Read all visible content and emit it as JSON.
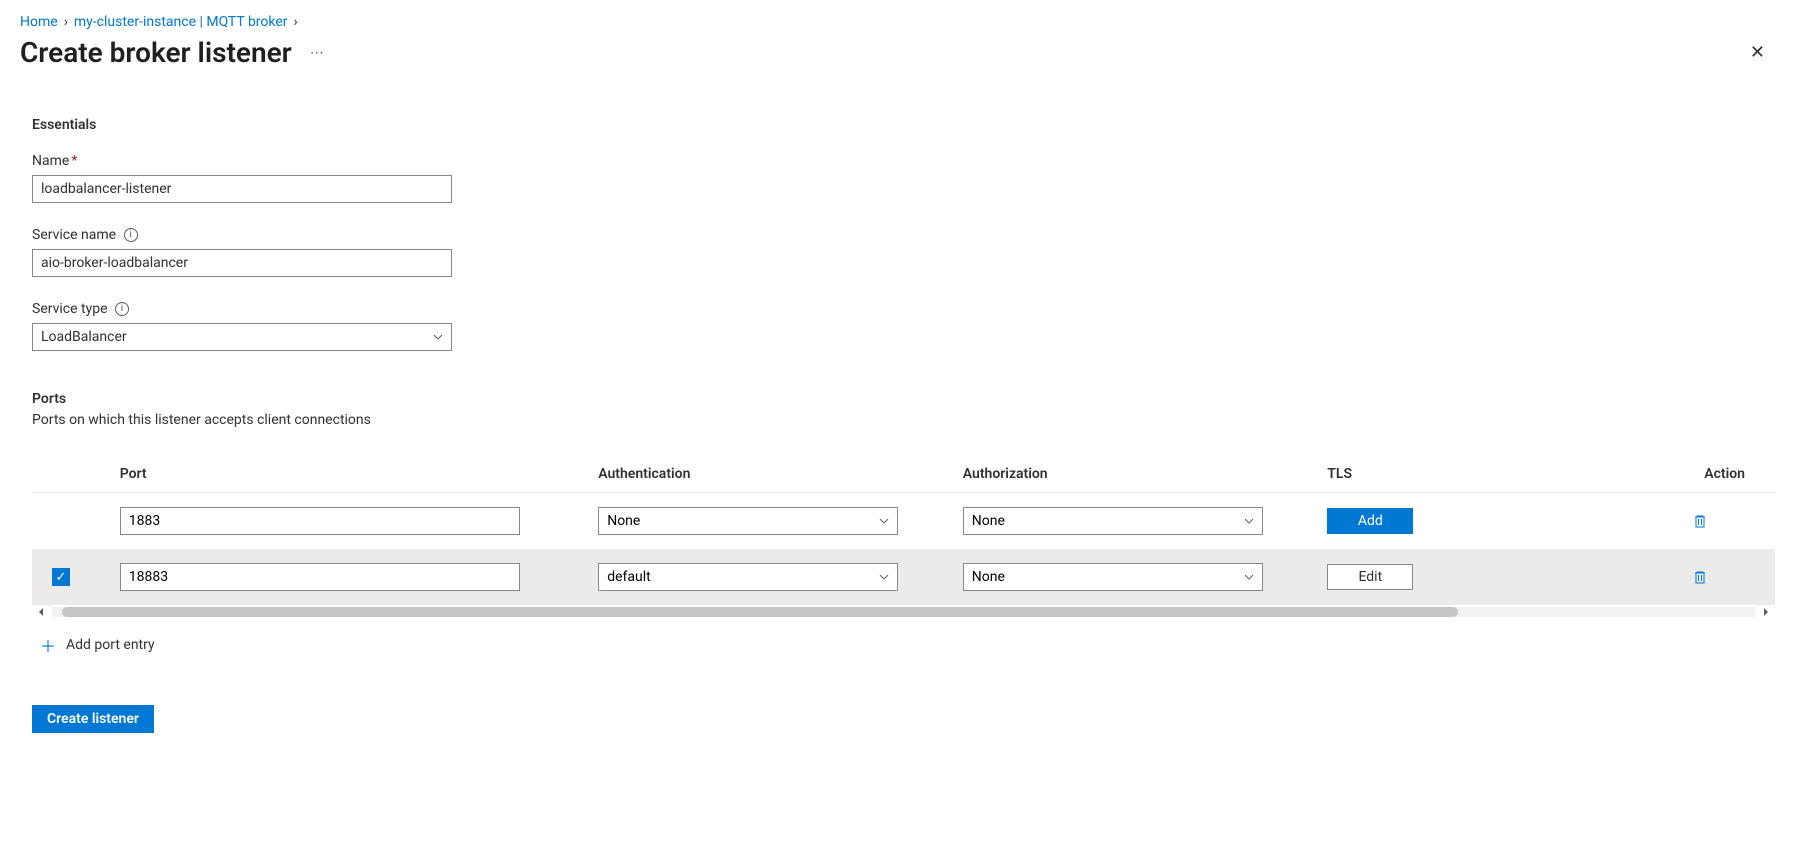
{
  "breadcrumb": {
    "items": [
      {
        "label": "Home"
      },
      {
        "label": "my-cluster-instance | MQTT broker"
      }
    ]
  },
  "header": {
    "title": "Create broker listener"
  },
  "essentials": {
    "section_title": "Essentials",
    "name_label": "Name",
    "name_value": "loadbalancer-listener",
    "service_name_label": "Service name",
    "service_name_value": "aio-broker-loadbalancer",
    "service_type_label": "Service type",
    "service_type_value": "LoadBalancer"
  },
  "ports": {
    "section_title": "Ports",
    "description": "Ports on which this listener accepts client connections",
    "columns": {
      "port": "Port",
      "authentication": "Authentication",
      "authorization": "Authorization",
      "tls": "TLS",
      "action": "Action"
    },
    "rows": [
      {
        "selected": false,
        "port": "1883",
        "authentication": "None",
        "authorization": "None",
        "tls_button": "Add",
        "tls_button_style": "primary"
      },
      {
        "selected": true,
        "port": "18883",
        "authentication": "default",
        "authorization": "None",
        "tls_button": "Edit",
        "tls_button_style": "secondary"
      }
    ],
    "add_label": "Add port entry"
  },
  "footer": {
    "create_label": "Create listener"
  }
}
